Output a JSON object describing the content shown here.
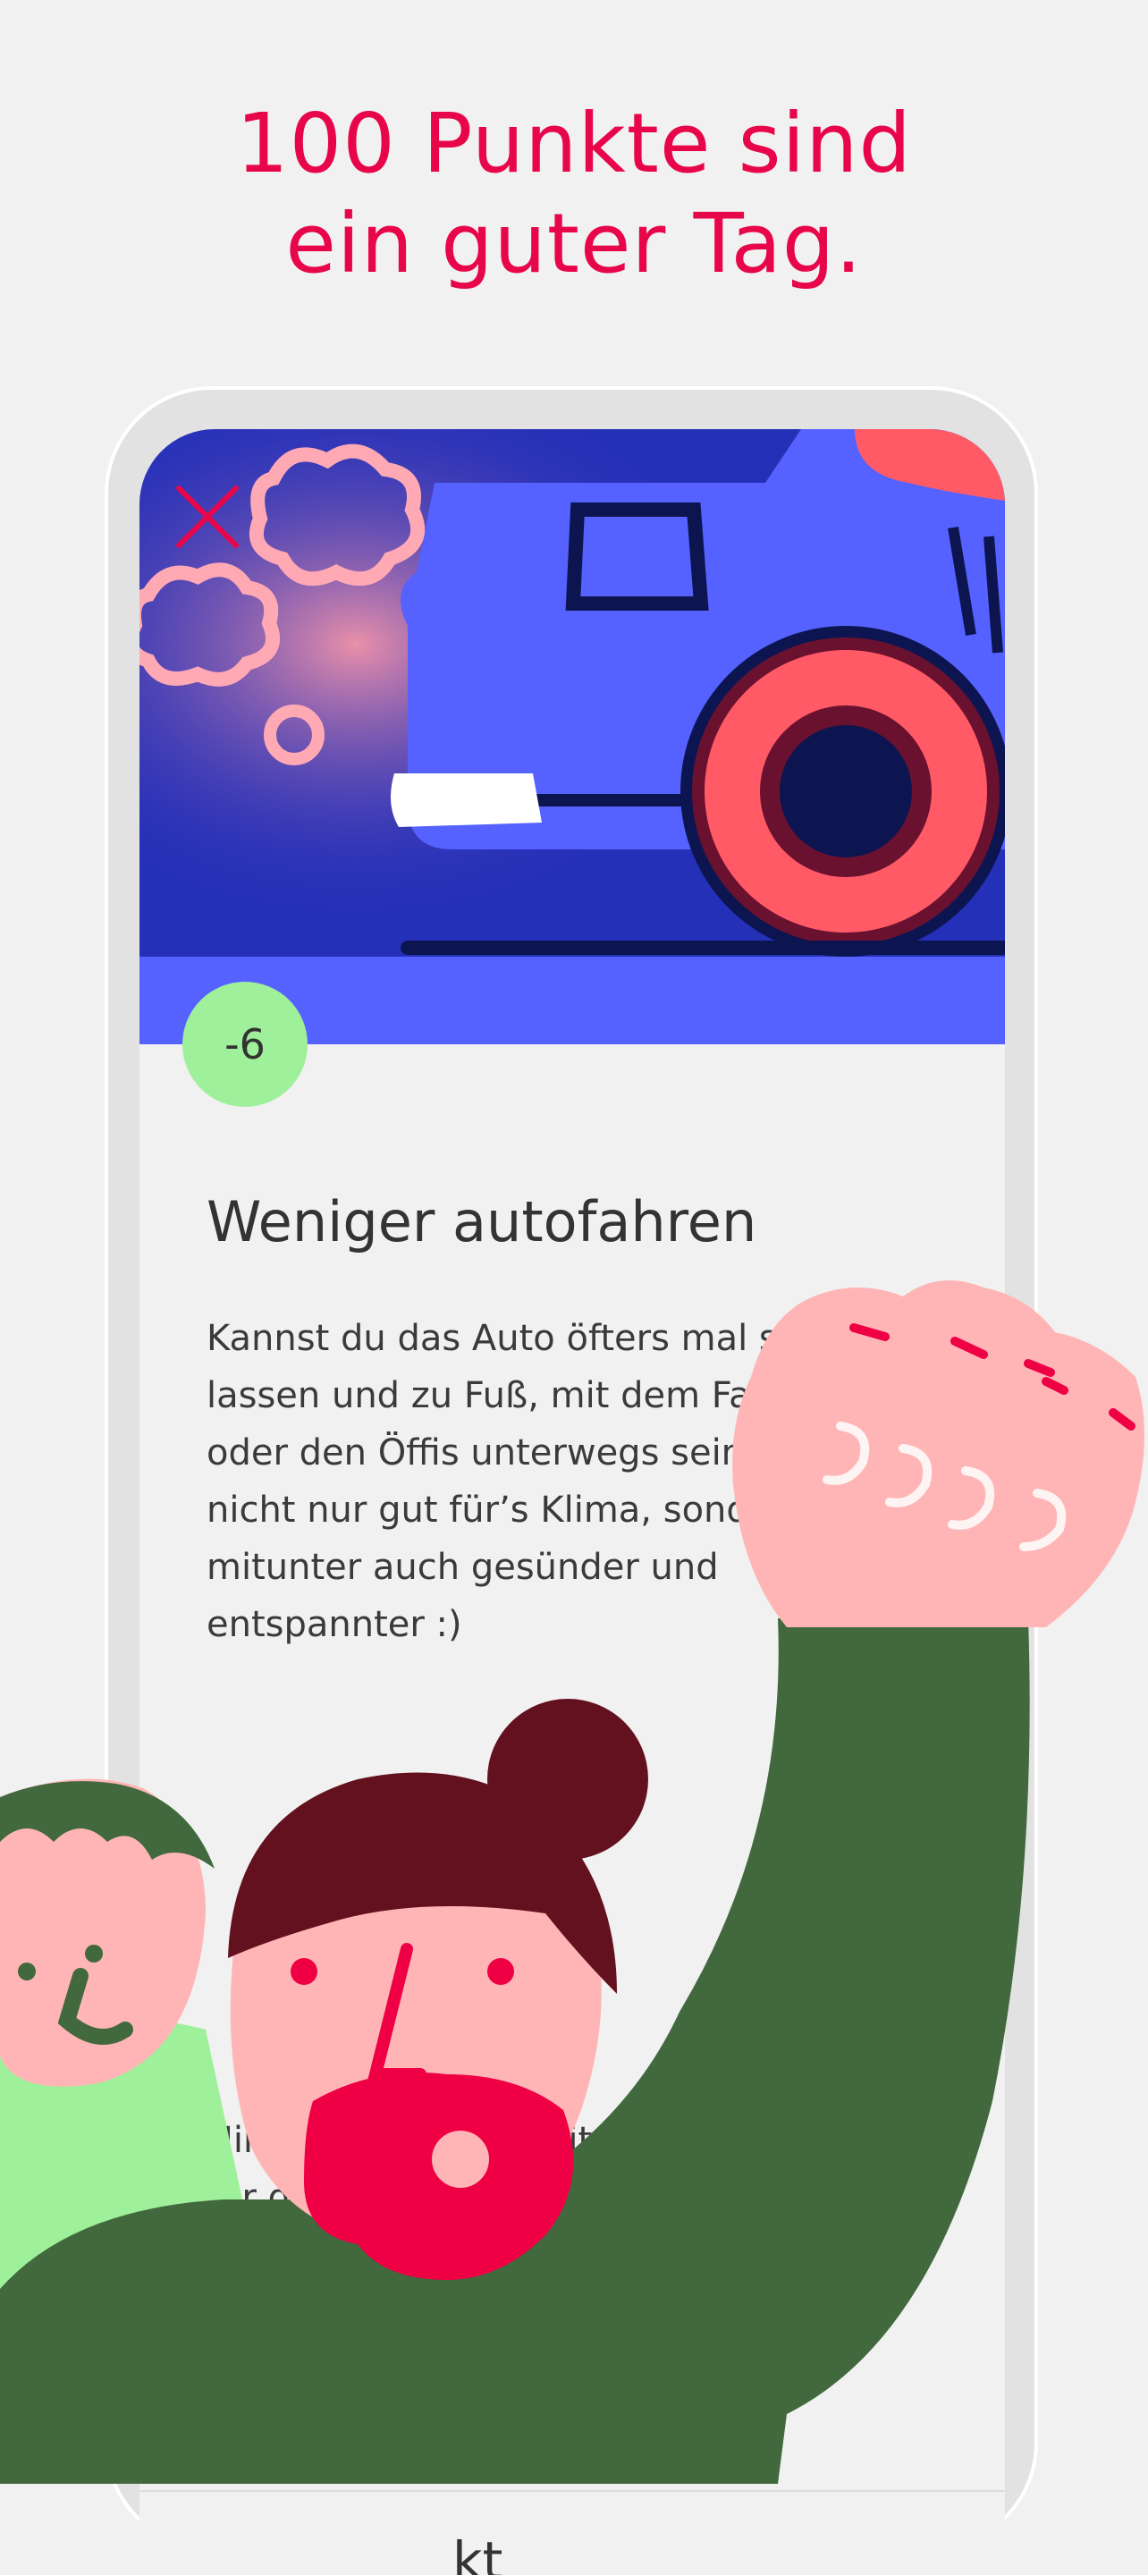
{
  "headline": {
    "line1": "100 Punkte sind",
    "line2": "ein guter Tag."
  },
  "card": {
    "close_icon": "close-icon",
    "points": "-6",
    "title": "Weniger autofahren",
    "paragraph1": "Kannst du das Auto öfters mal steh\nlassen und zu Fuß, mit dem Fa\noder den Öffis unterwegs sein\nnicht nur gut für’s Klima, sond\nmitunter auch gesünder und\nentspannter :)",
    "paragraph2": "Nimm dir was vor mit der Perspe\nfür das komm            Auf wie\nJahr                           zieren?\nAu                        Überleg,\nG                        mit den\nu                         Trag a",
    "next_heading_fragment": "kt"
  },
  "colors": {
    "accent": "#e8064a",
    "hero_bg": "#2530b8",
    "car": "#5562ff",
    "wheel": "#ff5a66",
    "badge": "#9ff09a",
    "sweater": "#41693d",
    "skin": "#ffb5b5",
    "hair": "#64111f",
    "light_green": "#9ff09a"
  }
}
